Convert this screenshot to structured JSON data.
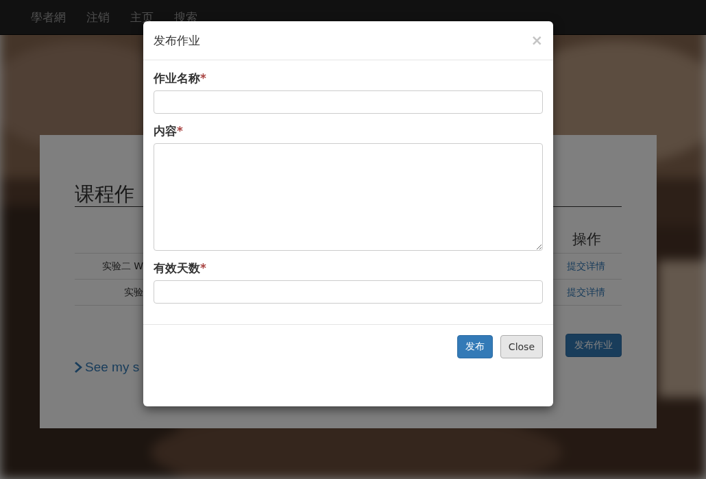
{
  "navbar": {
    "brand": "學者網",
    "links": [
      "注销",
      "主页",
      "搜索"
    ]
  },
  "page": {
    "heading": "课程作",
    "table": {
      "header": "操作",
      "rows": [
        {
          "title": "实验二 W",
          "action": "提交详情"
        },
        {
          "title": "实验",
          "action": "提交详情"
        }
      ]
    },
    "publish_button": "发布作业",
    "see_link": "See my s"
  },
  "modal": {
    "title": "发布作业",
    "close": "×",
    "fields": [
      {
        "label": "作业名称",
        "required_mark": "*",
        "kind": "input"
      },
      {
        "label": "内容",
        "required_mark": "*",
        "kind": "textarea"
      },
      {
        "label": "有效天数",
        "required_mark": "*",
        "kind": "input"
      }
    ],
    "buttons": [
      {
        "label": "发布",
        "kind": "primary"
      },
      {
        "label": "Close",
        "kind": "default"
      }
    ]
  }
}
